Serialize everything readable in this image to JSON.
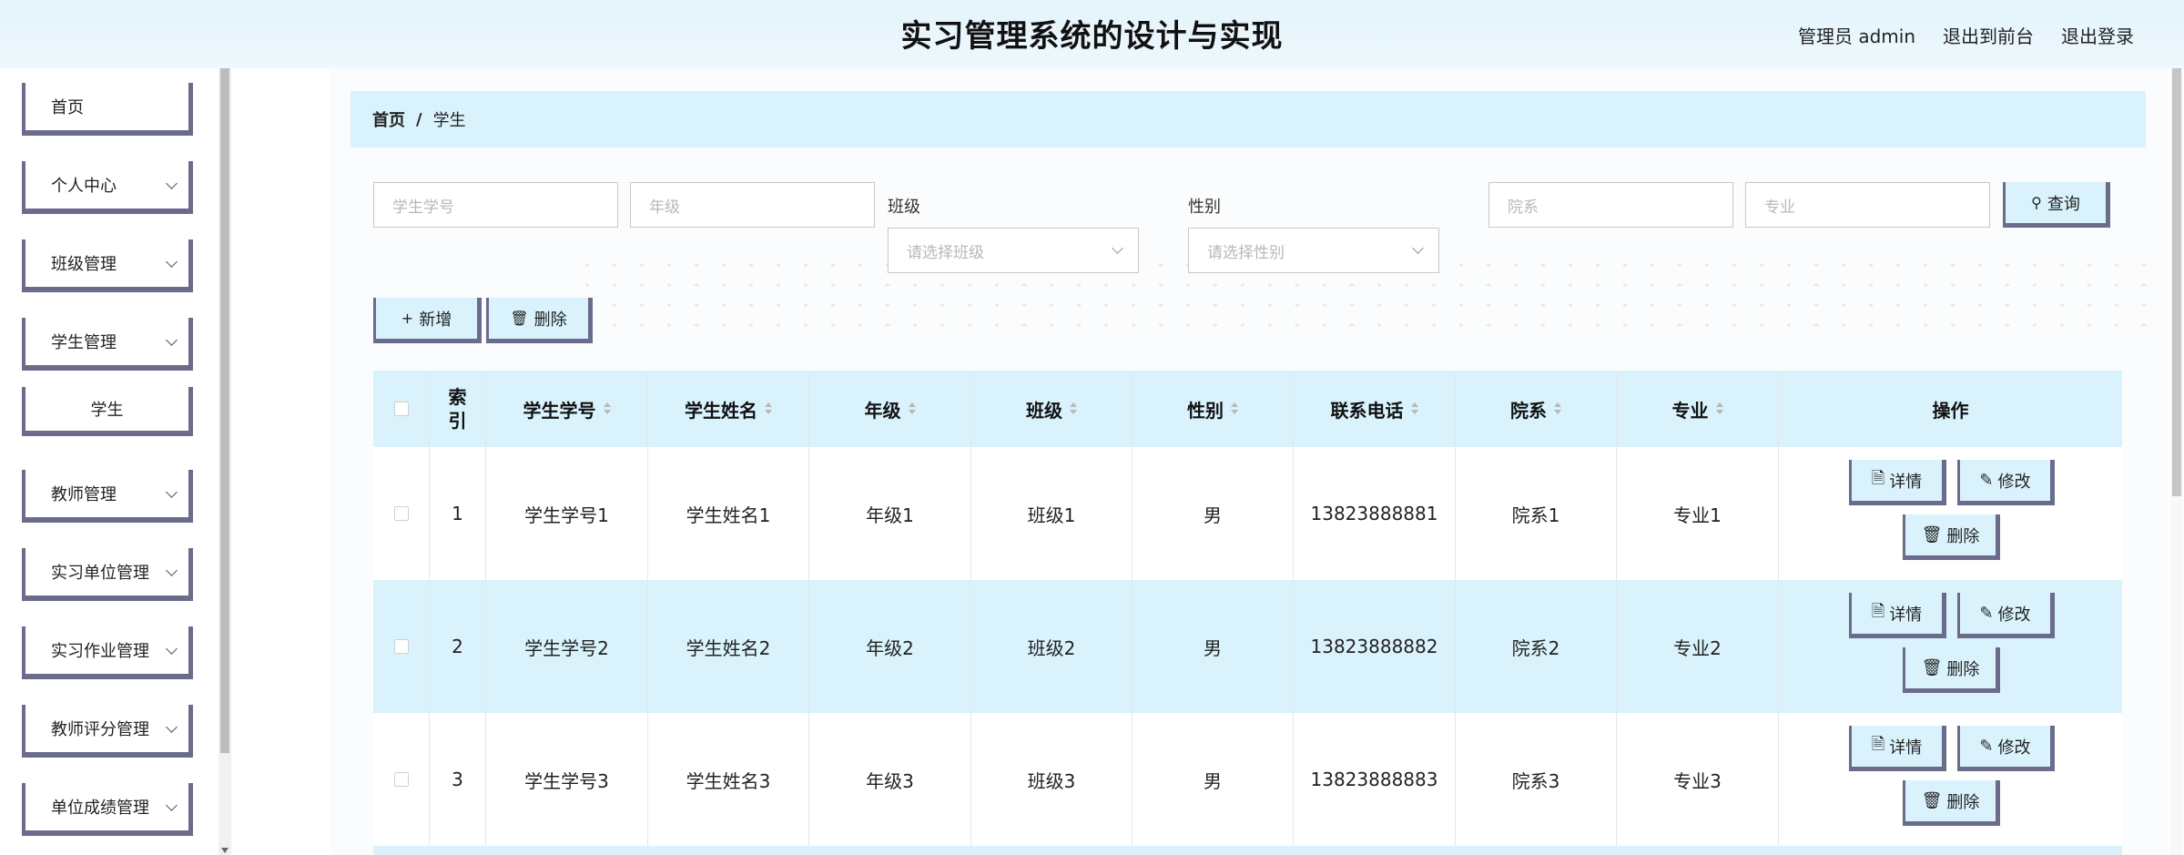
{
  "header": {
    "title": "实习管理系统的设计与实现",
    "admin": "管理员 admin",
    "front": "退出到前台",
    "logout": "退出登录"
  },
  "sidebar": {
    "items": [
      {
        "label": "首页"
      },
      {
        "label": "个人中心"
      },
      {
        "label": "班级管理"
      },
      {
        "label": "学生管理"
      },
      {
        "label": "学生"
      },
      {
        "label": "教师管理"
      },
      {
        "label": "实习单位管理"
      },
      {
        "label": "实习作业管理"
      },
      {
        "label": "教师评分管理"
      },
      {
        "label": "单位成绩管理"
      }
    ]
  },
  "breadcrumb": {
    "home": "首页",
    "sep": "/",
    "current": "学生"
  },
  "filters": {
    "student_no_placeholder": "学生学号",
    "grade_placeholder": "年级",
    "class_label": "班级",
    "class_placeholder": "请选择班级",
    "gender_label": "性别",
    "gender_placeholder": "请选择性别",
    "dept_placeholder": "院系",
    "major_placeholder": "专业",
    "query": "查询"
  },
  "actions": {
    "add": "新增",
    "delete": "删除"
  },
  "table": {
    "headers": {
      "index": "索\n引",
      "student_no": "学生学号",
      "student_name": "学生姓名",
      "grade": "年级",
      "class": "班级",
      "gender": "性别",
      "phone": "联系电话",
      "dept": "院系",
      "major": "专业",
      "ops": "操作"
    },
    "rows": [
      {
        "index": "1",
        "student_no": "学生学号1",
        "student_name": "学生姓名1",
        "grade": "年级1",
        "class": "班级1",
        "gender": "男",
        "phone": "13823888881",
        "dept": "院系1",
        "major": "专业1"
      },
      {
        "index": "2",
        "student_no": "学生学号2",
        "student_name": "学生姓名2",
        "grade": "年级2",
        "class": "班级2",
        "gender": "男",
        "phone": "13823888882",
        "dept": "院系2",
        "major": "专业2"
      },
      {
        "index": "3",
        "student_no": "学生学号3",
        "student_name": "学生姓名3",
        "grade": "年级3",
        "class": "班级3",
        "gender": "男",
        "phone": "13823888883",
        "dept": "院系3",
        "major": "专业3"
      }
    ],
    "op_labels": {
      "detail": "详情",
      "edit": "修改",
      "delete": "删除"
    }
  },
  "colors": {
    "accent": "#d9f2fc",
    "border": "#6b6b8c",
    "header_bg": "#e3f4fc"
  }
}
